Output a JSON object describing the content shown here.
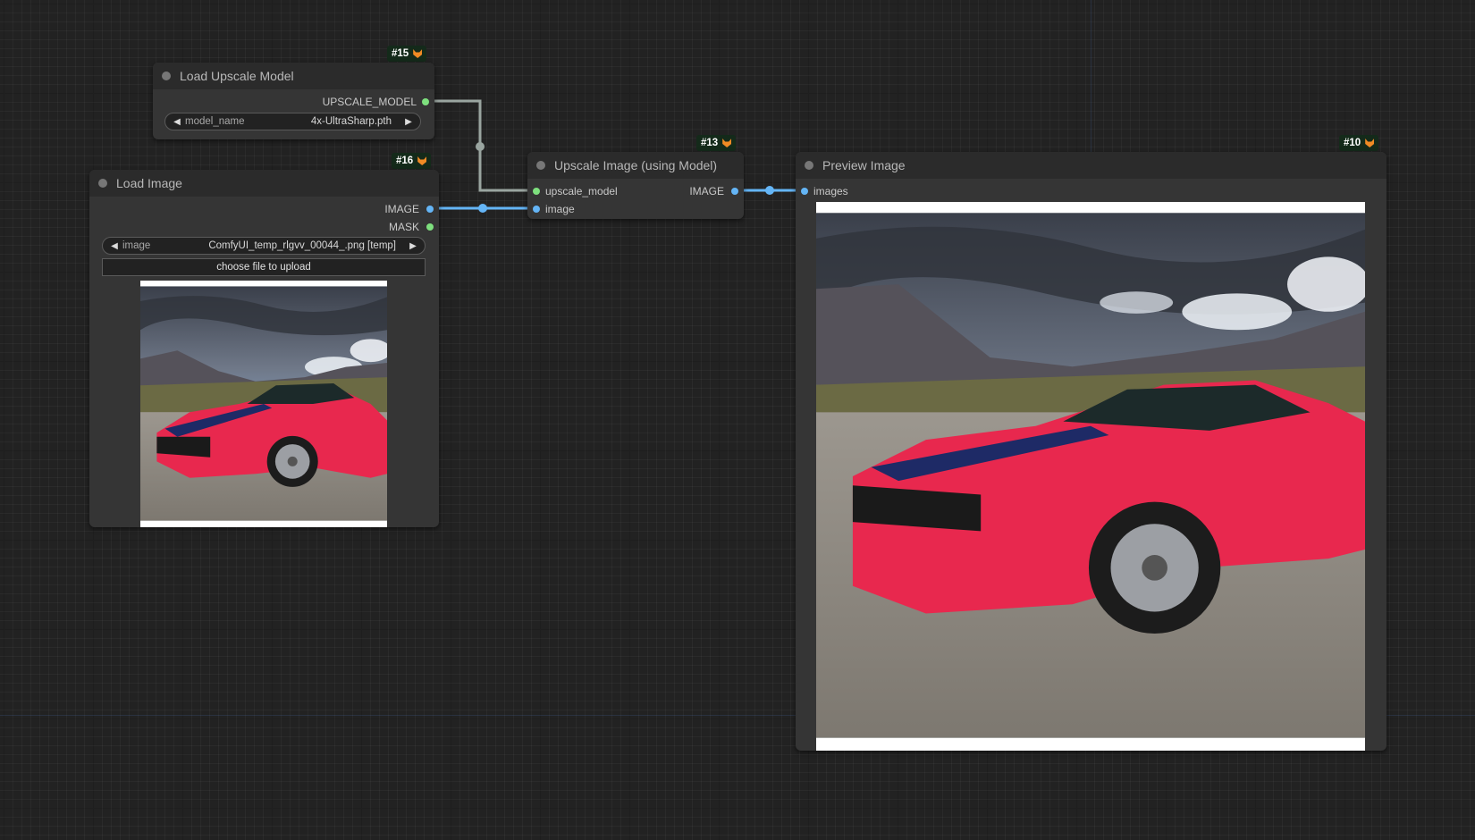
{
  "nodes": {
    "load_upscale_model": {
      "badge": "#15",
      "title": "Load Upscale Model",
      "outputs": [
        "UPSCALE_MODEL"
      ],
      "widget": {
        "label": "model_name",
        "value": "4x-UltraSharp.pth"
      }
    },
    "load_image": {
      "badge": "#16",
      "title": "Load Image",
      "outputs": [
        "IMAGE",
        "MASK"
      ],
      "widget": {
        "label": "image",
        "value": "ComfyUI_temp_rlgvv_00044_.png [temp]"
      },
      "upload_label": "choose file to upload"
    },
    "upscale_image": {
      "badge": "#13",
      "title": "Upscale Image (using Model)",
      "inputs": [
        "upscale_model",
        "image"
      ],
      "outputs": [
        "IMAGE"
      ]
    },
    "preview_image": {
      "badge": "#10",
      "title": "Preview Image",
      "inputs": [
        "images"
      ]
    }
  },
  "colors": {
    "canvas_bg": "#222222",
    "node_bg": "#353535",
    "node_header": "#2b2b2b",
    "model_link": "#9aa5a0",
    "image_link": "#64b5f6",
    "model_slot": "#7ee07e",
    "image_slot": "#64b5f6",
    "car_red": "#e8284e"
  },
  "icons": {
    "badge": "fox-icon",
    "combo_prev": "triangle-left-icon",
    "combo_next": "triangle-right-icon"
  }
}
